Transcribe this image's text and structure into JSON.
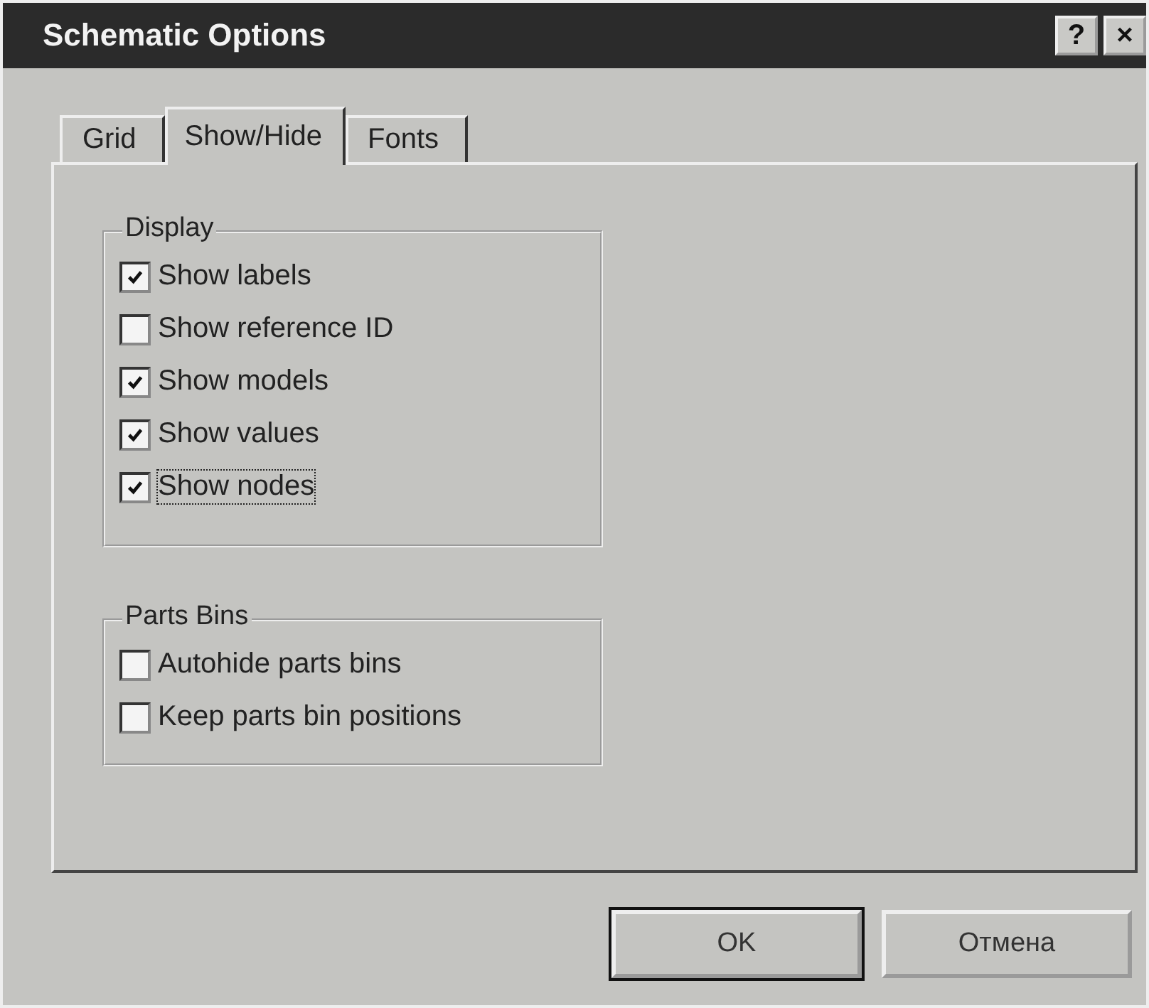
{
  "window": {
    "title": "Schematic Options",
    "title_buttons": [
      "?",
      "×"
    ]
  },
  "tabs": [
    {
      "label": "Grid",
      "selected": false
    },
    {
      "label": "Show/Hide",
      "selected": true
    },
    {
      "label": "Fonts",
      "selected": false
    }
  ],
  "groups": [
    {
      "title": "Display",
      "items": [
        {
          "label": "Show labels",
          "checked": true,
          "focused": false
        },
        {
          "label": "Show reference ID",
          "checked": false,
          "focused": false
        },
        {
          "label": "Show models",
          "checked": true,
          "focused": false
        },
        {
          "label": "Show values",
          "checked": true,
          "focused": false
        },
        {
          "label": "Show nodes",
          "checked": true,
          "focused": true
        }
      ]
    },
    {
      "title": "Parts Bins",
      "items": [
        {
          "label": "Autohide parts bins",
          "checked": false,
          "focused": false
        },
        {
          "label": "Keep parts bin positions",
          "checked": false,
          "focused": false
        }
      ]
    }
  ],
  "buttons": [
    "OK",
    "Отмена"
  ]
}
